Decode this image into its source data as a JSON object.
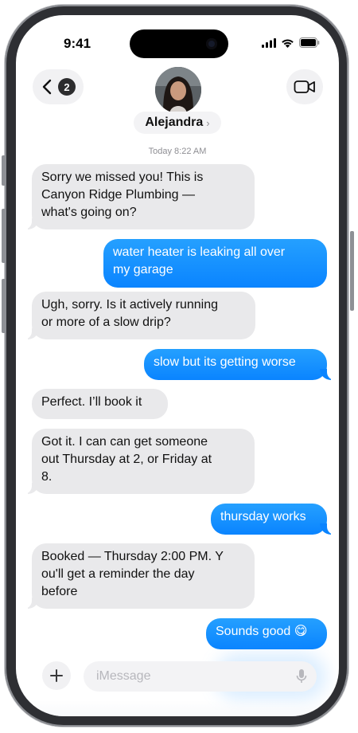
{
  "status_bar": {
    "time": "9:41"
  },
  "header": {
    "back_badge": "2",
    "contact_name": "Alejandra",
    "name_chevron": "›"
  },
  "timestamp": {
    "day": "Today",
    "time": "8:22 AM"
  },
  "messages": [
    {
      "from": "them",
      "text": "Sorry we missed you! This is\nCanyon Ridge Plumbing —\nwhat's going on?"
    },
    {
      "from": "me",
      "text": "water heater is leaking all over\nmy garage"
    },
    {
      "from": "them",
      "text": "Ugh, sorry. Is it actively running\nor more of a slow drip?"
    },
    {
      "from": "me",
      "text": "slow but its getting worse"
    },
    {
      "from": "them",
      "text": "Perfect. I’ll book it"
    },
    {
      "from": "them",
      "text": "Got it. I can can get someone\nout Thursday at 2, or Friday at\n8."
    },
    {
      "from": "me",
      "text": "thursday works"
    },
    {
      "from": "them",
      "text": "Booked — Thursday 2:00 PM. Y\nou'll get a reminder the day\nbefore"
    },
    {
      "from": "me",
      "text": "Sounds good 😋"
    }
  ],
  "composer": {
    "placeholder": "iMessage"
  },
  "icons": {
    "back": "chevron-left-icon",
    "video": "video-camera-icon",
    "plus": "plus-icon",
    "mic": "microphone-icon",
    "signal": "cellular-signal-icon",
    "wifi": "wifi-icon",
    "battery": "battery-icon"
  },
  "colors": {
    "outgoing": "#0a84ff",
    "incoming": "#e9e9eb"
  }
}
